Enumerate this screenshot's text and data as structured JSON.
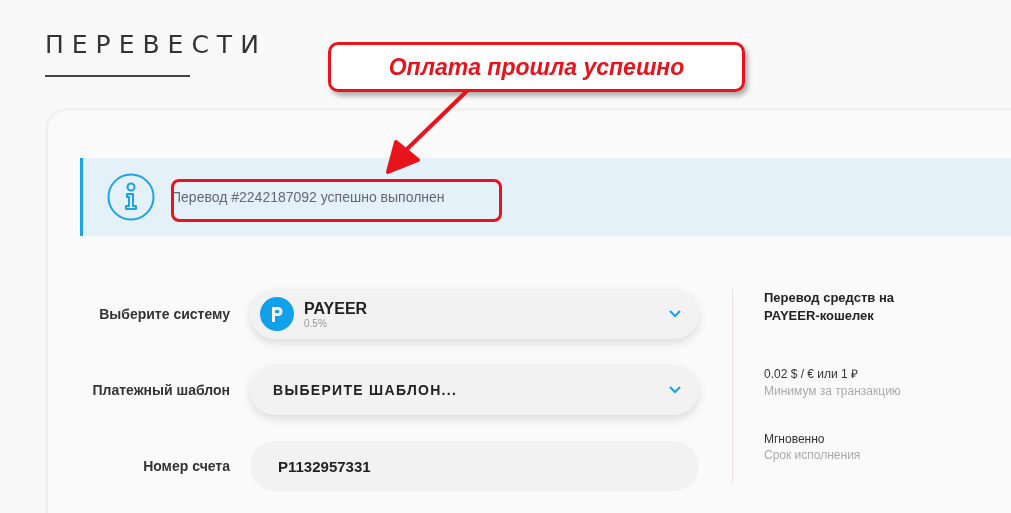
{
  "page_title": "ПЕРЕВЕСТИ",
  "notice": {
    "text": "Перевод #2242187092 успешно выполнен"
  },
  "annotation": {
    "label": "Оплата прошла успешно"
  },
  "form": [
    {
      "kind": "system",
      "label": "Выберите систему",
      "value": "PAYEER",
      "sub": "0.5%"
    },
    {
      "kind": "select",
      "label": "Платежный шаблон",
      "value": "ВЫБЕРИТЕ ШАБЛОН..."
    },
    {
      "kind": "input",
      "label": "Номер счета",
      "value": "P1132957331"
    }
  ],
  "info": {
    "heading": "Перевод средств на PAYEER-кошелек",
    "items": [
      {
        "value": "0.02 $ / € или 1 ₽",
        "caption": "Минимум за транзакцию"
      },
      {
        "value": "Мгновенно",
        "caption": "Срок исполнения"
      }
    ]
  }
}
